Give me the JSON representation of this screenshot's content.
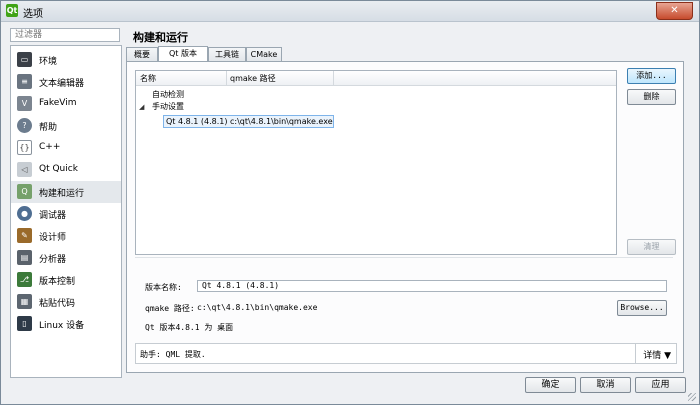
{
  "window": {
    "title": "选项",
    "app_icon": "Qt",
    "close_glyph": "✕"
  },
  "sidebar": {
    "filter_placeholder": "过滤器",
    "items": [
      {
        "label": "环境",
        "icon": "monitor-icon",
        "color": "#3b4048"
      },
      {
        "label": "文本编辑器",
        "icon": "text-editor-icon",
        "color": "#6a7480"
      },
      {
        "label": "FakeVim",
        "icon": "fakevim-icon",
        "color": "#7c8590"
      },
      {
        "label": "帮助",
        "icon": "help-icon",
        "color": "#6c7c8e"
      },
      {
        "label": "C++",
        "icon": "cpp-icon",
        "color": "#8a939d"
      },
      {
        "label": "Qt Quick",
        "icon": "qt-quick-icon",
        "color": "#a3acb6"
      },
      {
        "label": "构建和运行",
        "icon": "build-run-icon",
        "color": "#76a16b"
      },
      {
        "label": "调试器",
        "icon": "debugger-icon",
        "color": "#4f6e92"
      },
      {
        "label": "设计师",
        "icon": "designer-icon",
        "color": "#9a6a2a"
      },
      {
        "label": "分析器",
        "icon": "analyzer-icon",
        "color": "#5a626b"
      },
      {
        "label": "版本控制",
        "icon": "version-control-icon",
        "color": "#3c7a3a"
      },
      {
        "label": "粘贴代码",
        "icon": "paste-code-icon",
        "color": "#5d6670"
      },
      {
        "label": "Linux 设备",
        "icon": "linux-device-icon",
        "color": "#2e3a48"
      }
    ],
    "selected_index": 6
  },
  "page": {
    "title": "构建和运行",
    "tabs": [
      {
        "label": "概要"
      },
      {
        "label": "Qt 版本"
      },
      {
        "label": "工具链"
      },
      {
        "label": "CMake"
      }
    ],
    "active_tab": 1
  },
  "tree": {
    "col_name": "名称",
    "col_qmake": "qmake 路径",
    "auto_detected": "自动检测",
    "manual": "手动设置",
    "arrow_glyph": "◢",
    "selected_row": "Qt 4.8.1 (4.8.1)  c:\\qt\\4.8.1\\bin\\qmake.exe"
  },
  "buttons": {
    "add": "添加...",
    "remove": "删除",
    "clean": "清理",
    "browse": "Browse..."
  },
  "details": {
    "name_label": "版本名称:",
    "name_value": "Qt 4.8.1 (4.8.1)",
    "qmake_label": "qmake 路径:",
    "qmake_value": "c:\\qt\\4.8.1\\bin\\qmake.exe",
    "info": "Qt 版本4.8.1 为 桌面"
  },
  "helper": {
    "text": "助手: QML 提取.",
    "details_label": "详情 ▼"
  },
  "footer": {
    "ok": "确定",
    "cancel": "取消",
    "apply": "应用"
  }
}
